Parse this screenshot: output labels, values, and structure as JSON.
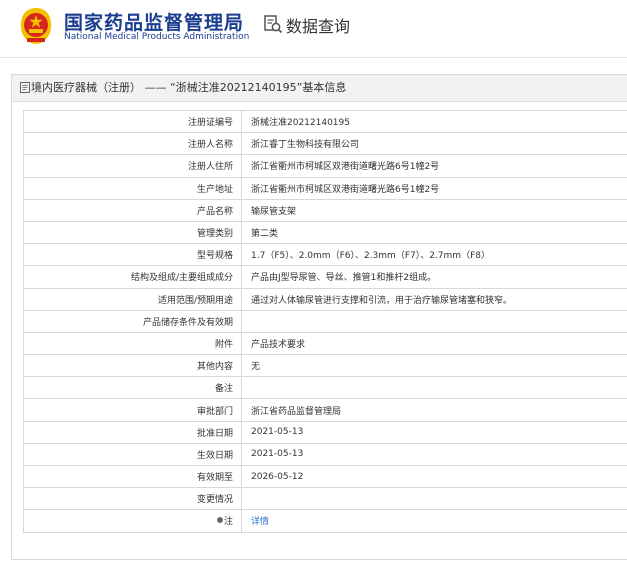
{
  "header": {
    "org_name_cn": "国家药品监督管理局",
    "org_name_en": "National Medical Products Administration",
    "query_title": "数据查询",
    "emblem_icon": "national-emblem-icon",
    "query_icon": "document-search-icon"
  },
  "panel": {
    "title": "境内医疗器械（注册） —— “浙械注准20212140195”基本信息",
    "title_icon": "document-icon"
  },
  "rows": [
    {
      "label": "注册证编号",
      "value": "浙械注准20212140195"
    },
    {
      "label": "注册人名称",
      "value": "浙江睿丁生物科技有限公司"
    },
    {
      "label": "注册人住所",
      "value": "浙江省衢州市柯城区双港街道曙光路6号1幢2号"
    },
    {
      "label": "生产地址",
      "value": "浙江省衢州市柯城区双港街道曙光路6号1幢2号"
    },
    {
      "label": "产品名称",
      "value": "输尿管支架"
    },
    {
      "label": "管理类别",
      "value": "第二类"
    },
    {
      "label": "型号规格",
      "value": "1.7（F5）、2.0mm（F6）、2.3mm（F7）、2.7mm（F8）"
    },
    {
      "label": "结构及组成/主要组成成分",
      "value": "产品由J型导尿管、导丝、推管1和推杆2组成。"
    },
    {
      "label": "适用范围/预期用途",
      "value": "通过对人体输尿管进行支撑和引流，用于治疗输尿管堵塞和狭窄。"
    },
    {
      "label": "产品储存条件及有效期",
      "value": ""
    },
    {
      "label": "附件",
      "value": "产品技术要求"
    },
    {
      "label": "其他内容",
      "value": "无"
    },
    {
      "label": "备注",
      "value": ""
    },
    {
      "label": "审批部门",
      "value": "浙江省药品监督管理局"
    },
    {
      "label": "批准日期",
      "value": "2021-05-13"
    },
    {
      "label": "生效日期",
      "value": "2021-05-13"
    },
    {
      "label": "有效期至",
      "value": "2026-05-12"
    },
    {
      "label": "变更情况",
      "value": ""
    }
  ],
  "note_row": {
    "label": "注",
    "link_text": "详情",
    "icon": "info-dot-icon"
  },
  "colors": {
    "brand_blue": "#1a3d8f",
    "link_blue": "#2a6fd1",
    "emblem_red": "#d7261d",
    "emblem_gold": "#f2c200"
  }
}
